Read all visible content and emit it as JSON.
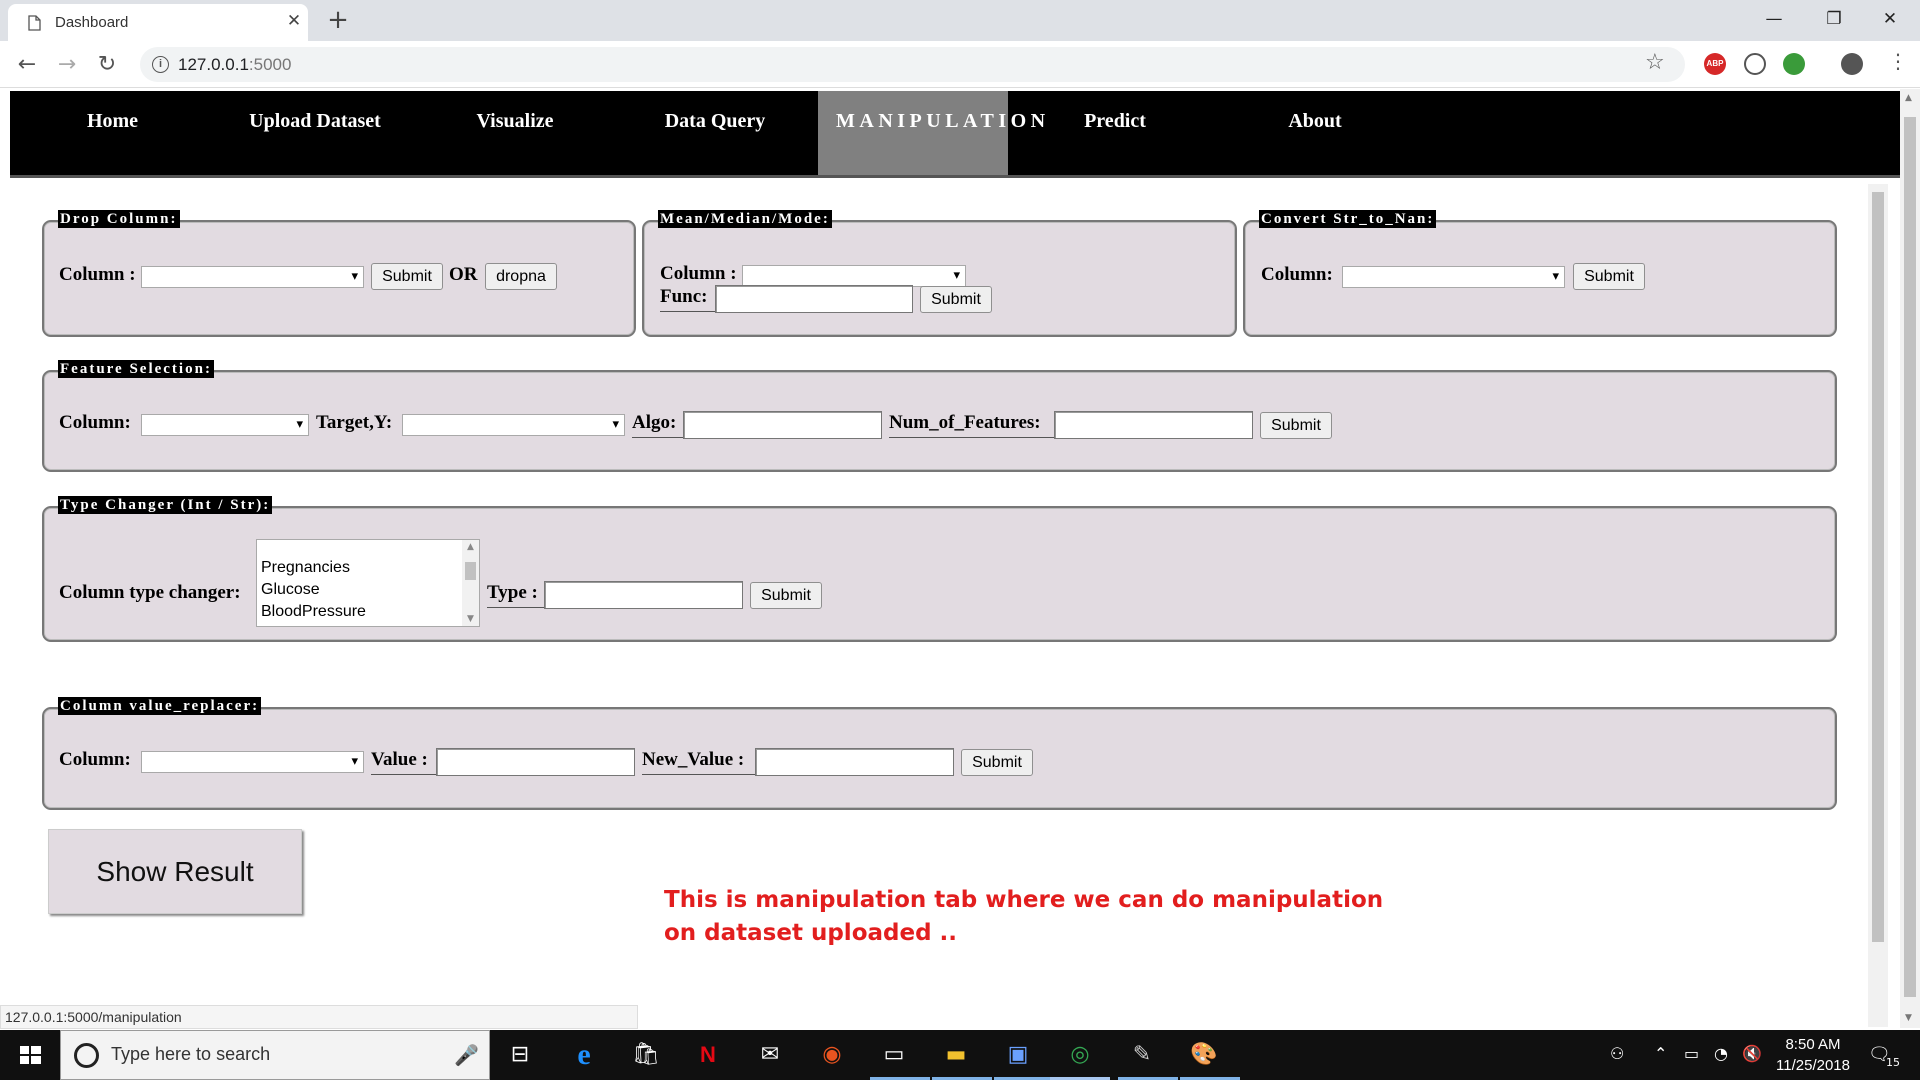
{
  "browser": {
    "tab_title": "Dashboard",
    "tab_close": "✕",
    "new_tab": "+",
    "url_host": "127.0.0.1",
    "url_port": ":5000",
    "minimize": "—",
    "maximize": "❐",
    "close": "✕",
    "extensions": [
      "ABP"
    ]
  },
  "nav": {
    "items": [
      "Home",
      "Upload Dataset",
      "Visualize",
      "Data Query",
      "MANIPULATION",
      "Predict",
      "About"
    ],
    "active": "MANIPULATION"
  },
  "drop_column": {
    "legend": "Drop Column:",
    "column_label": "Column :",
    "submit": "Submit",
    "or_label": "OR",
    "dropna": "dropna"
  },
  "mean_median_mode": {
    "legend": "Mean/Median/Mode:",
    "column_label": "Column :",
    "func_label": "Func:",
    "submit": "Submit"
  },
  "convert": {
    "legend": "Convert Str_to_Nan:",
    "column_label": "Column:",
    "submit": "Submit"
  },
  "feature_selection": {
    "legend": "Feature Selection:",
    "column_label": "Column:",
    "target_label": "Target,Y:",
    "algo_label": "Algo:",
    "num_label": "Num_of_Features:",
    "submit": "Submit"
  },
  "type_changer": {
    "legend": "Type Changer (Int / Str):",
    "label": "Column type changer:",
    "options": [
      "Pregnancies",
      "Glucose",
      "BloodPressure"
    ],
    "type_label": "Type :",
    "submit": "Submit"
  },
  "value_replacer": {
    "legend": "Column value_replacer:",
    "column_label": "Column:",
    "value_label": "Value :",
    "new_value_label": "New_Value :",
    "submit": "Submit"
  },
  "show_result": "Show Result",
  "annotation": "This is manipulation tab where we can do manipulation on dataset uploaded ..",
  "status_url": "127.0.0.1:5000/manipulation",
  "taskbar": {
    "search_placeholder": "Type here to search",
    "time": "8:50 AM",
    "date": "11/25/2018",
    "notification_count": "15"
  }
}
